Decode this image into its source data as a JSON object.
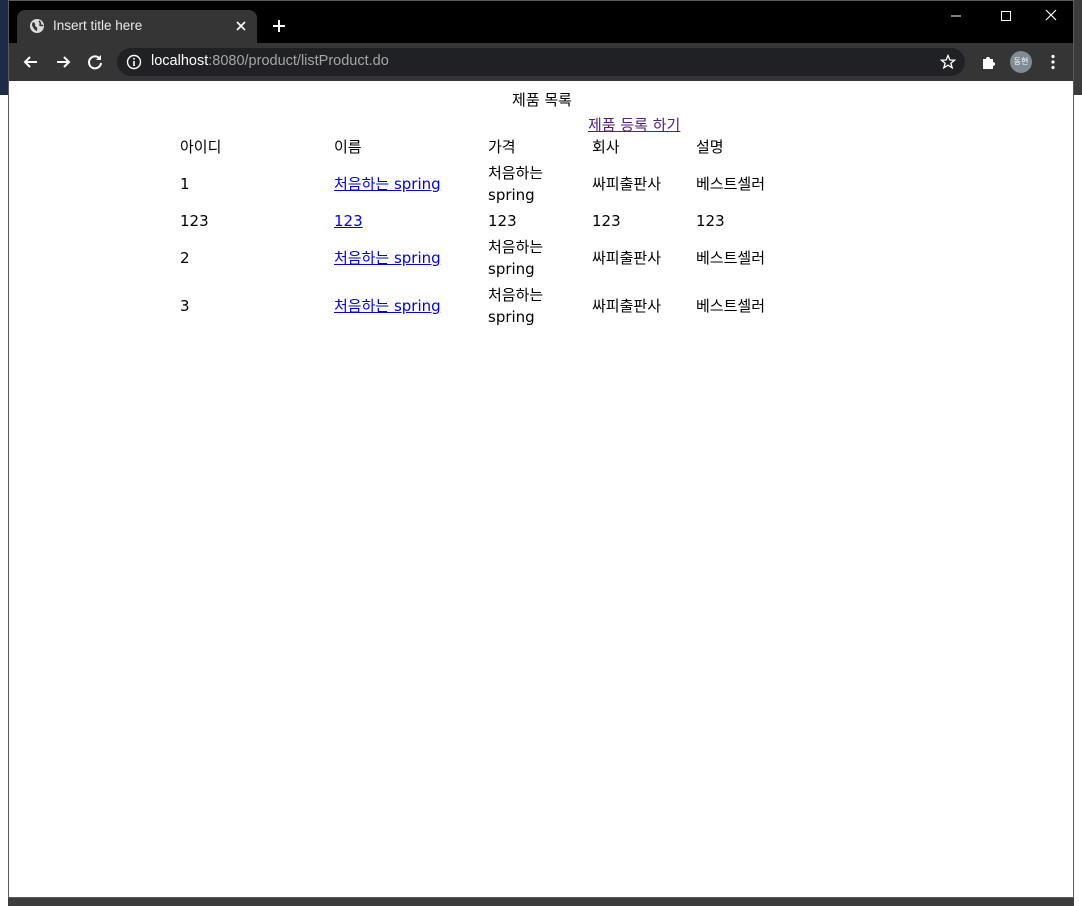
{
  "browser": {
    "tab_title": "Insert title here",
    "url_host": "localhost",
    "url_rest": ":8080/product/listProduct.do",
    "profile_initials": "동현"
  },
  "page": {
    "title": "제품 목록",
    "register_link": "제품 등록 하기",
    "table": {
      "headers": [
        "아이디",
        "이름",
        "가격",
        "회사",
        "설명"
      ],
      "rows": [
        {
          "id": "1",
          "name": "처음하는 spring",
          "price": "처음하는 spring",
          "company": "싸피출판사",
          "description": "베스트셀러"
        },
        {
          "id": "123",
          "name": "123",
          "price": "123",
          "company": "123",
          "description": "123"
        },
        {
          "id": "2",
          "name": "처음하는 spring",
          "price": "처음하는 spring",
          "company": "싸피출판사",
          "description": "베스트셀러"
        },
        {
          "id": "3",
          "name": "처음하는 spring",
          "price": "처음하는 spring",
          "company": "싸피출판사",
          "description": "베스트셀러"
        }
      ]
    }
  }
}
